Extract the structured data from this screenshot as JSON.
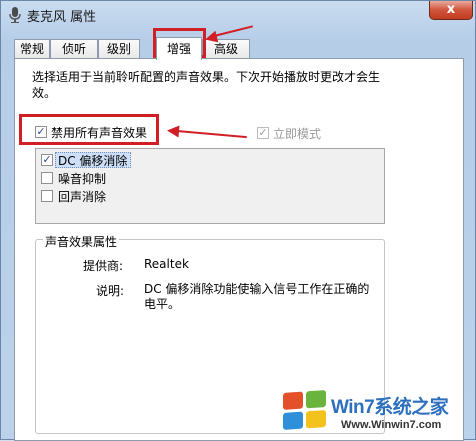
{
  "window": {
    "title": "麦克风 属性",
    "close_label": "x"
  },
  "tabs": [
    {
      "label": "常规"
    },
    {
      "label": "侦听"
    },
    {
      "label": "级别"
    },
    {
      "label": "增强"
    },
    {
      "label": "高级"
    }
  ],
  "active_tab": "增强",
  "enhance": {
    "description": "选择适用于当前聆听配置的声音效果。下次开始播放时更改才会生效。",
    "disable_all": {
      "label": "禁用所有声音效果",
      "checked": true
    },
    "immediate_mode": {
      "label": "立即模式",
      "checked": true,
      "enabled": false
    },
    "effects": [
      {
        "label": "DC 偏移消除",
        "checked": true,
        "selected": true
      },
      {
        "label": "噪音抑制",
        "checked": false
      },
      {
        "label": "回声消除",
        "checked": false
      }
    ],
    "properties": {
      "title": "声音效果属性",
      "provider_label": "提供商:",
      "provider_value": "Realtek",
      "desc_label": "说明:",
      "desc_value": "DC 偏移消除功能使输入信号工作在正确的电平。"
    }
  },
  "watermark": {
    "brand": "Win7系统之家",
    "url": "Www.Winwin7.com"
  },
  "colors": {
    "annotation": "#d21f26",
    "selection": "#cde0f7",
    "accent": "#2d6fbf"
  }
}
